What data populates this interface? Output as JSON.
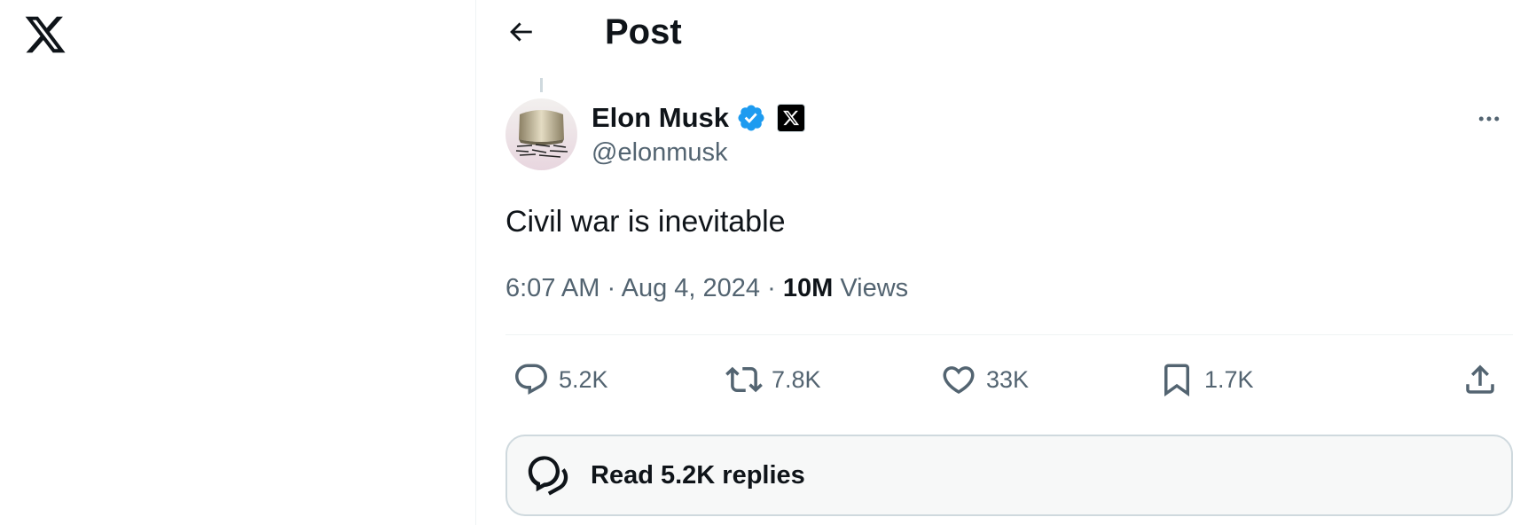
{
  "nav": {
    "logo_icon": "x-logo-icon"
  },
  "header": {
    "back_icon": "arrow-left-icon",
    "title": "Post"
  },
  "author": {
    "name": "Elon Musk",
    "handle": "@elonmusk",
    "verified_icon": "verified-badge-icon",
    "verified_color": "#1d9bf0",
    "affiliation_icon": "x-affiliation-icon"
  },
  "post": {
    "text": "Civil war is inevitable",
    "time": "6:07 AM",
    "date": "Aug 4, 2024",
    "separator": "·",
    "views_count": "10M",
    "views_label": "Views"
  },
  "actions": [
    {
      "name": "reply",
      "icon": "reply-icon",
      "count": "5.2K"
    },
    {
      "name": "repost",
      "icon": "repost-icon",
      "count": "7.8K"
    },
    {
      "name": "like",
      "icon": "heart-icon",
      "count": "33K"
    },
    {
      "name": "bookmark",
      "icon": "bookmark-icon",
      "count": "1.7K"
    },
    {
      "name": "share",
      "icon": "share-icon",
      "count": ""
    }
  ],
  "read_replies": {
    "icon": "speech-bubbles-icon",
    "label": "Read 5.2K replies"
  },
  "colors": {
    "text": "#0f1419",
    "secondary": "#536471",
    "border": "#cfd9de",
    "accent": "#1d9bf0"
  }
}
